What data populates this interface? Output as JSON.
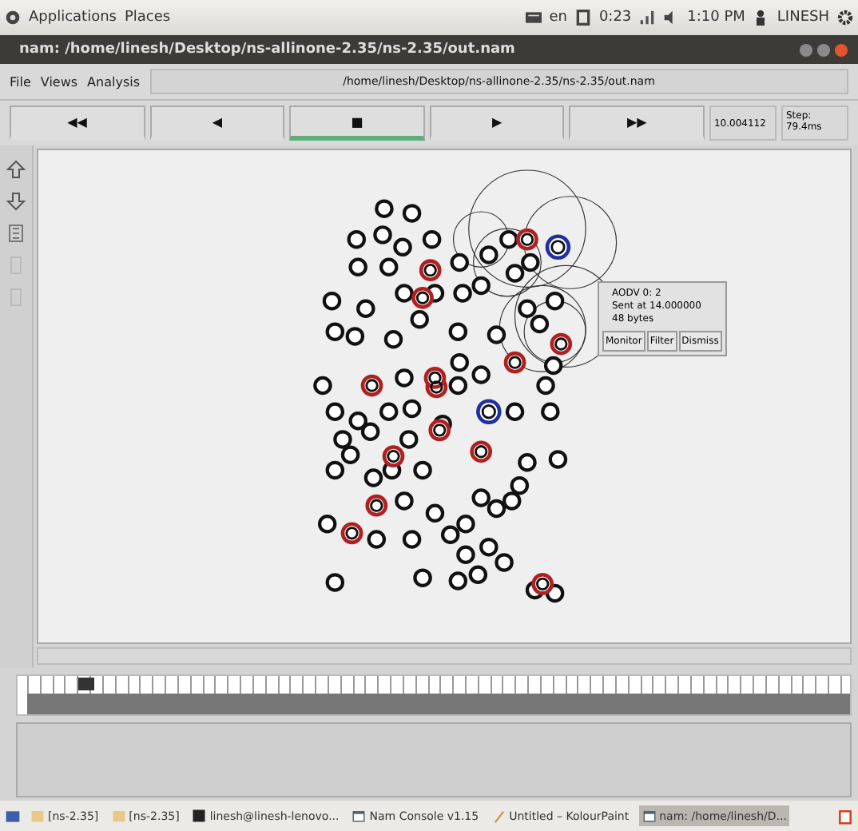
{
  "top_panel": {
    "menus": [
      "Applications",
      "Places"
    ],
    "keyboard": "en",
    "battery": "0:23",
    "clock": "1:10 PM",
    "user": "LINESH"
  },
  "window": {
    "title": "nam: /home/linesh/Desktop/ns-allinone-2.35/ns-2.35/out.nam"
  },
  "menu": [
    "File",
    "Views",
    "Analysis"
  ],
  "file_path": "/home/linesh/Desktop/ns-allinone-2.35/ns-2.35/out.nam",
  "controls": [
    {
      "label": "◀◀",
      "selected": false
    },
    {
      "label": "◀",
      "selected": false
    },
    {
      "label": "■",
      "selected": true
    },
    {
      "label": "▶",
      "selected": false
    },
    {
      "label": "▶▶",
      "selected": false
    }
  ],
  "time": "10.004112",
  "step": "Step: 79.4ms",
  "popup": {
    "lines": [
      "AODV 0: 2",
      "Sent at 14.000000",
      "48 bytes"
    ],
    "buttons": [
      "Monitor",
      "Filter",
      "Dismiss"
    ]
  },
  "taskbar": [
    {
      "label": "[ns-2.35]",
      "kind": "folder",
      "selected": false
    },
    {
      "label": "[ns-2.35]",
      "kind": "folder",
      "selected": false
    },
    {
      "label": "linesh@linesh-lenovo...",
      "kind": "terminal",
      "selected": false
    },
    {
      "label": "Nam Console v1.15",
      "kind": "window",
      "selected": false
    },
    {
      "label": "Untitled – KolourPaint",
      "kind": "paint",
      "selected": false
    },
    {
      "label": "nam: /home/linesh/D...",
      "kind": "window",
      "selected": true
    }
  ]
}
